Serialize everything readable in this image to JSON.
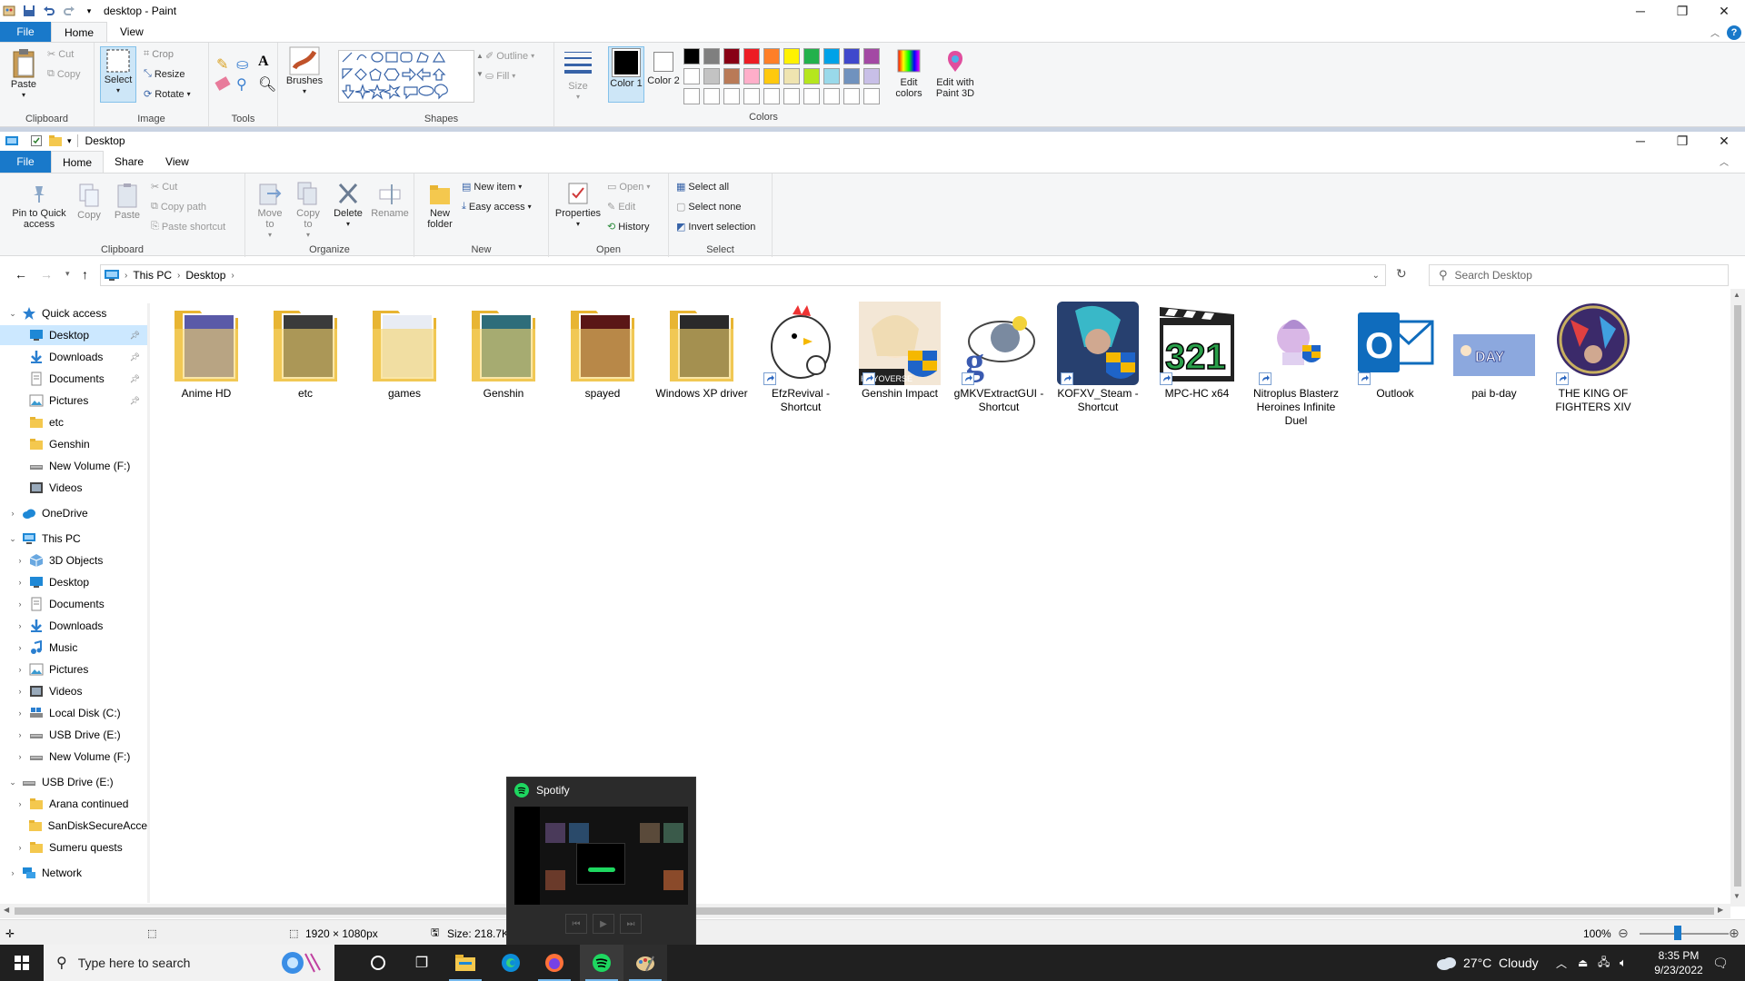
{
  "paint": {
    "title": "desktop - Paint",
    "tabs": [
      "File",
      "Home",
      "View"
    ],
    "clipboard": {
      "paste": "Paste",
      "cut": "Cut",
      "copy": "Copy",
      "label": "Clipboard"
    },
    "image": {
      "select": "Select",
      "crop": "Crop",
      "resize": "Resize",
      "rotate": "Rotate",
      "label": "Image"
    },
    "tools_label": "Tools",
    "brushes": "Brushes",
    "shapes": {
      "outline": "Outline",
      "fill": "Fill",
      "label": "Shapes"
    },
    "size": "Size",
    "color1": "Color 1",
    "color2": "Color 2",
    "colors_label": "Colors",
    "edit_colors": "Edit colors",
    "edit_3d": "Edit with Paint 3D",
    "palette_row1": [
      "#000000",
      "#7f7f7f",
      "#880015",
      "#ed1c24",
      "#ff7f27",
      "#fff200",
      "#22b14c",
      "#00a2e8",
      "#3f48cc",
      "#a349a4"
    ],
    "palette_row2": [
      "#ffffff",
      "#c3c3c3",
      "#b97a57",
      "#ffaec9",
      "#ffc90e",
      "#efe4b0",
      "#b5e61d",
      "#99d9ea",
      "#7092be",
      "#c8bfe7"
    ],
    "palette_row3": [
      "#ffffff",
      "#ffffff",
      "#ffffff",
      "#ffffff",
      "#ffffff",
      "#ffffff",
      "#ffffff",
      "#ffffff",
      "#ffffff",
      "#ffffff"
    ],
    "status": {
      "dimensions": "1920 × 1080px",
      "size": "Size: 218.7KB",
      "zoom": "100%"
    }
  },
  "explorer": {
    "title": "Desktop",
    "tabs": [
      "File",
      "Home",
      "Share",
      "View"
    ],
    "ribbon": {
      "pin": "Pin to Quick access",
      "copy": "Copy",
      "paste": "Paste",
      "cut": "Cut",
      "copy_path": "Copy path",
      "paste_shortcut": "Paste shortcut",
      "clipboard_label": "Clipboard",
      "move_to": "Move to",
      "copy_to": "Copy to",
      "delete": "Delete",
      "rename": "Rename",
      "organize_label": "Organize",
      "new_folder": "New folder",
      "new_item": "New item",
      "easy_access": "Easy access",
      "new_label": "New",
      "properties": "Properties",
      "open": "Open",
      "edit": "Edit",
      "history": "History",
      "open_label": "Open",
      "select_all": "Select all",
      "select_none": "Select none",
      "invert_selection": "Invert selection",
      "select_label": "Select"
    },
    "address": {
      "this_pc": "This PC",
      "desktop": "Desktop"
    },
    "search_placeholder": "Search Desktop",
    "nav": [
      {
        "label": "Quick access",
        "level": 0,
        "expanded": true,
        "icon": "star-icon"
      },
      {
        "label": "Desktop",
        "level": 1,
        "pinned": true,
        "selected": true,
        "icon": "desktop-icon"
      },
      {
        "label": "Downloads",
        "level": 1,
        "pinned": true,
        "icon": "download-icon"
      },
      {
        "label": "Documents",
        "level": 1,
        "pinned": true,
        "icon": "document-icon"
      },
      {
        "label": "Pictures",
        "level": 1,
        "pinned": true,
        "icon": "picture-icon"
      },
      {
        "label": "etc",
        "level": 1,
        "icon": "folder-icon"
      },
      {
        "label": "Genshin",
        "level": 1,
        "icon": "folder-icon"
      },
      {
        "label": "New Volume (F:)",
        "level": 1,
        "icon": "drive-icon"
      },
      {
        "label": "Videos",
        "level": 1,
        "icon": "video-icon"
      },
      {
        "label": "OneDrive",
        "level": 0,
        "collapsed": true,
        "icon": "cloud-icon"
      },
      {
        "label": "This PC",
        "level": 0,
        "expanded": true,
        "icon": "pc-icon"
      },
      {
        "label": "3D Objects",
        "level": 1,
        "collapsed": true,
        "icon": "cube-icon"
      },
      {
        "label": "Desktop",
        "level": 1,
        "collapsed": true,
        "icon": "desktop-icon"
      },
      {
        "label": "Documents",
        "level": 1,
        "collapsed": true,
        "icon": "document-icon"
      },
      {
        "label": "Downloads",
        "level": 1,
        "collapsed": true,
        "icon": "download-icon"
      },
      {
        "label": "Music",
        "level": 1,
        "collapsed": true,
        "icon": "music-icon"
      },
      {
        "label": "Pictures",
        "level": 1,
        "collapsed": true,
        "icon": "picture-icon"
      },
      {
        "label": "Videos",
        "level": 1,
        "collapsed": true,
        "icon": "video-icon"
      },
      {
        "label": "Local Disk (C:)",
        "level": 1,
        "collapsed": true,
        "icon": "disk-icon"
      },
      {
        "label": "USB Drive (E:)",
        "level": 1,
        "collapsed": true,
        "icon": "drive-icon"
      },
      {
        "label": "New Volume (F:)",
        "level": 1,
        "collapsed": true,
        "icon": "drive-icon"
      },
      {
        "label": "USB Drive (E:)",
        "level": 0,
        "expanded": true,
        "icon": "drive-icon"
      },
      {
        "label": "Arana continued",
        "level": 1,
        "collapsed": true,
        "icon": "folder-icon"
      },
      {
        "label": "SanDiskSecureAcce",
        "level": 1,
        "icon": "folder-icon"
      },
      {
        "label": "Sumeru quests",
        "level": 1,
        "collapsed": true,
        "icon": "folder-icon"
      },
      {
        "label": "Network",
        "level": 0,
        "collapsed": true,
        "icon": "network-icon"
      }
    ],
    "files": [
      {
        "label": "Anime HD",
        "kind": "folder",
        "tint": "#5a5aa8"
      },
      {
        "label": "etc",
        "kind": "folder",
        "tint": "#3b3b3b"
      },
      {
        "label": "games",
        "kind": "folder",
        "tint": "#e8ecf4"
      },
      {
        "label": "Genshin",
        "kind": "folder",
        "tint": "#2e6d7a"
      },
      {
        "label": "spayed",
        "kind": "folder",
        "tint": "#5a1616"
      },
      {
        "label": "Windows XP driver",
        "kind": "folder",
        "tint": "#2a2a2a"
      },
      {
        "label": "EfzRevival - Shortcut",
        "kind": "shortcut",
        "tint": "#ffffff"
      },
      {
        "label": "Genshin Impact",
        "kind": "app",
        "tint": "#f3e7d6"
      },
      {
        "label": "gMKVExtractGUI - Shortcut",
        "kind": "shortcut",
        "tint": "#ffffff"
      },
      {
        "label": "KOFXV_Steam - Shortcut",
        "kind": "shortcut",
        "tint": "#27406f"
      },
      {
        "label": "MPC-HC x64",
        "kind": "shortcut",
        "tint": "#ffffff"
      },
      {
        "label": "Nitroplus Blasterz Heroines Infinite Duel",
        "kind": "shortcut",
        "tint": "#ffffff"
      },
      {
        "label": "Outlook",
        "kind": "shortcut",
        "tint": "#ffffff"
      },
      {
        "label": "pai b-day",
        "kind": "image",
        "tint": "#6c8fd0"
      },
      {
        "label": "THE KING OF FIGHTERS XIV",
        "kind": "shortcut",
        "tint": "#3b2a6a"
      }
    ],
    "thumb_text": {
      "genshin_badge": "HOYOVERSE",
      "mpc_numbers": "321",
      "outlook_letter": "O",
      "birthday_text": "DAY"
    }
  },
  "spotify": {
    "title": "Spotify"
  },
  "taskbar": {
    "search_placeholder": "Type here to search",
    "weather": "27°C  Cloudy",
    "time": "8:35 PM",
    "date": "9/23/2022"
  }
}
